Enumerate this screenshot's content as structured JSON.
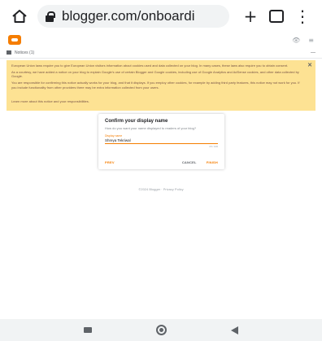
{
  "browser": {
    "home_icon": "home-icon",
    "url": "blogger.com/onboardi",
    "new_tab_symbol": "+",
    "tab_count": "",
    "menu_symbol": "⋮"
  },
  "blogger_bar": {
    "logo": "blogger-logo",
    "view_icon": "👁",
    "menu_icon": "≡"
  },
  "notices": {
    "label": "Notices (1)",
    "collapse_symbol": "—",
    "close_symbol": "✕",
    "paragraphs": [
      "European Union laws require you to give European Union visitors information about cookies used and data collected on your blog. In many cases, these laws also require you to obtain consent.",
      "As a courtesy, we have added a notice on your blog to explain Google's use of certain Blogger and Google cookies, including use of Google Analytics and AdSense cookies, and other data collected by Google.",
      "You are responsible for confirming this notice actually works for your blog, and that it displays. If you employ other cookies, for example by adding third party features, this notice may not work for you. If you include functionality from other providers there may be extra information collected from your users."
    ],
    "link": "Learn more about this notice and your responsibilities."
  },
  "dialog": {
    "title": "Confirm your display name",
    "question": "How do you want your name displayed to readers of your blog?",
    "field_label": "Display name",
    "field_value": "Shreya Tekriwal",
    "char_count": "15 / 100",
    "prev_label": "PREV",
    "cancel_label": "CANCEL",
    "finish_label": "FINISH"
  },
  "footer": {
    "text": "©2024 Blogger · Privacy Policy"
  },
  "colors": {
    "accent": "#f57d00",
    "notice_bg": "#fde293"
  }
}
